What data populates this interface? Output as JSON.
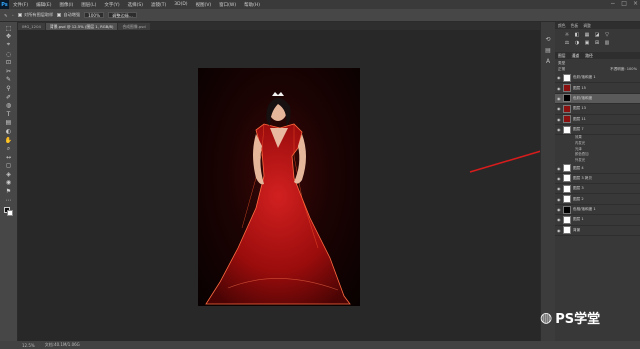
{
  "menubar": {
    "logo": "Ps",
    "items": [
      "文件(F)",
      "编辑(E)",
      "图像(I)",
      "图层(L)",
      "文字(Y)",
      "选择(S)",
      "滤镜(T)",
      "3D(D)",
      "视图(V)",
      "窗口(W)",
      "帮助(H)"
    ]
  },
  "options": {
    "opt1": "对所有图层取样",
    "opt2": "自动增强",
    "opt3": "100%",
    "opt4": "调整边缘..."
  },
  "tabs": [
    {
      "label": "IMG_1204"
    },
    {
      "label": "背景.psd @ 12.5% (图层 1, RGB/8)"
    },
    {
      "label": "合成图像.psd"
    }
  ],
  "tools": [
    "⬚",
    "✥",
    "⌖",
    "◌",
    "⊡",
    "✂",
    "✎",
    "⚲",
    "✐",
    "◍",
    "T",
    "▤",
    "◐",
    "✋",
    "⌕",
    "↔",
    "◻",
    "◈",
    "◉",
    "⚑",
    "⋯"
  ],
  "right": {
    "panel_header": [
      "颜色",
      "色板",
      "调整"
    ],
    "adj_icons": [
      "☼",
      "◧",
      "▦",
      "◪",
      "▽",
      "⚖",
      "◑",
      "▣",
      "⊞",
      "▥"
    ],
    "layers_tabs": [
      "图层",
      "通道",
      "路径"
    ],
    "kind": "类型",
    "mode": "正常",
    "opacity": "不透明度: 100%",
    "lock": "锁定:",
    "fill": "填充: 100%",
    "layers": [
      {
        "name": "色彩/饱和度 1",
        "thumb": "white",
        "selected": false
      },
      {
        "name": "图层 15",
        "thumb": "red",
        "selected": false
      },
      {
        "name": "色彩/饱和度",
        "thumb": "blk",
        "selected": true
      },
      {
        "name": "图层 13",
        "thumb": "red",
        "selected": false
      },
      {
        "name": "图层 11",
        "thumb": "red",
        "selected": false
      },
      {
        "name": "图层 7",
        "thumb": "white",
        "selected": false
      }
    ],
    "effects": [
      "效果",
      "内发光",
      "光泽",
      "颜色叠加",
      "外发光"
    ],
    "layers2": [
      {
        "name": "图层 4",
        "thumb": "white"
      },
      {
        "name": "图层 3 拷贝",
        "thumb": "white"
      },
      {
        "name": "图层 3",
        "thumb": "white"
      },
      {
        "name": "图层 2",
        "thumb": "white"
      },
      {
        "name": "色相/饱和度 1",
        "thumb": "blk"
      },
      {
        "name": "图层 1",
        "thumb": "white"
      },
      {
        "name": "背景",
        "thumb": "white"
      }
    ]
  },
  "status": {
    "zoom": "12.5%",
    "doc": "文档:40.1M/1.06G"
  },
  "watermark": "PS学堂"
}
